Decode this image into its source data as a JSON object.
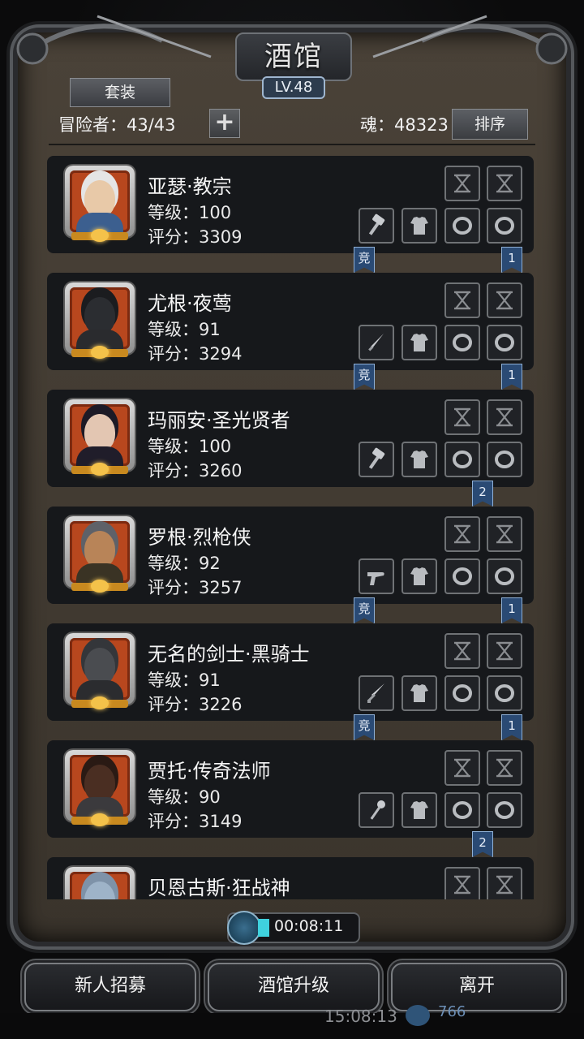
{
  "header": {
    "title": "酒馆",
    "level": "LV.48",
    "suit_button": "套装",
    "adventurers": "冒险者：43/43",
    "add_button": "+",
    "soul": "魂：48323",
    "sort_button": "排序"
  },
  "heroes": [
    {
      "name": "亚瑟·教宗",
      "level": "等级：100",
      "score": "评分：3309",
      "weapon": "hammer",
      "tags": [
        "竞",
        "1"
      ],
      "portrait": "white-hair"
    },
    {
      "name": "尤根·夜莺",
      "level": "等级：91",
      "score": "评分：3294",
      "weapon": "dagger",
      "tags": [
        "竞",
        "1"
      ],
      "portrait": "masked"
    },
    {
      "name": "玛丽安·圣光贤者",
      "level": "等级：100",
      "score": "评分：3260",
      "weapon": "hammer",
      "tags": [
        "2"
      ],
      "portrait": "nun"
    },
    {
      "name": "罗根·烈枪侠",
      "level": "等级：92",
      "score": "评分：3257",
      "weapon": "pistol",
      "tags": [
        "竞",
        "1"
      ],
      "portrait": "gunner"
    },
    {
      "name": "无名的剑士·黑骑士",
      "level": "等级：91",
      "score": "评分：3226",
      "weapon": "sword",
      "tags": [
        "竞",
        "1"
      ],
      "portrait": "helm"
    },
    {
      "name": "贾托·传奇法师",
      "level": "等级：90",
      "score": "评分：3149",
      "weapon": "staff",
      "tags": [
        "2"
      ],
      "portrait": "mage"
    },
    {
      "name": "贝恩古斯·狂战神",
      "level": "",
      "score": "",
      "weapon": "",
      "tags": [],
      "portrait": "beast"
    }
  ],
  "timer": "00:08:11",
  "buttons": {
    "recruit": "新人招募",
    "upgrade": "酒馆升级",
    "leave": "离开"
  },
  "status": {
    "clock": "15:08:13",
    "gems": "766"
  },
  "colors": {
    "frame": "#3f382f",
    "card": "#16181b",
    "portrait_bg": "#b8471e",
    "tag": "#2a4a74",
    "timer_fill": "#3fd2de"
  }
}
